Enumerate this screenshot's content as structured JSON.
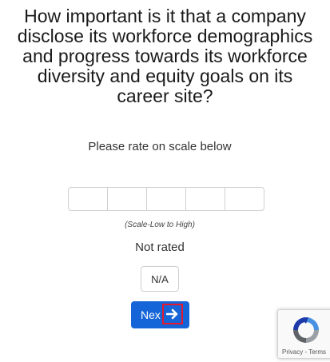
{
  "question": {
    "line1": "How important is it that a company",
    "line2": "disclose its workforce demographics",
    "line3": "and progress towards its workforce",
    "line4": "diversity and equity goals on its",
    "line5": "career site?"
  },
  "instruction": "Please rate on scale below",
  "scale": {
    "cells": 5,
    "hint": "(Scale-Low to High)"
  },
  "rating_status": "Not rated",
  "na_label": "N/A",
  "next_label": "Nex",
  "recaptcha": {
    "privacy": "Privacy",
    "separator": " - ",
    "terms": "Terms"
  },
  "colors": {
    "primary_button": "#1565d8",
    "highlight_box": "#e5182f"
  },
  "icons": {
    "next": "arrow-right-icon",
    "captcha": "recaptcha-logo-icon"
  }
}
